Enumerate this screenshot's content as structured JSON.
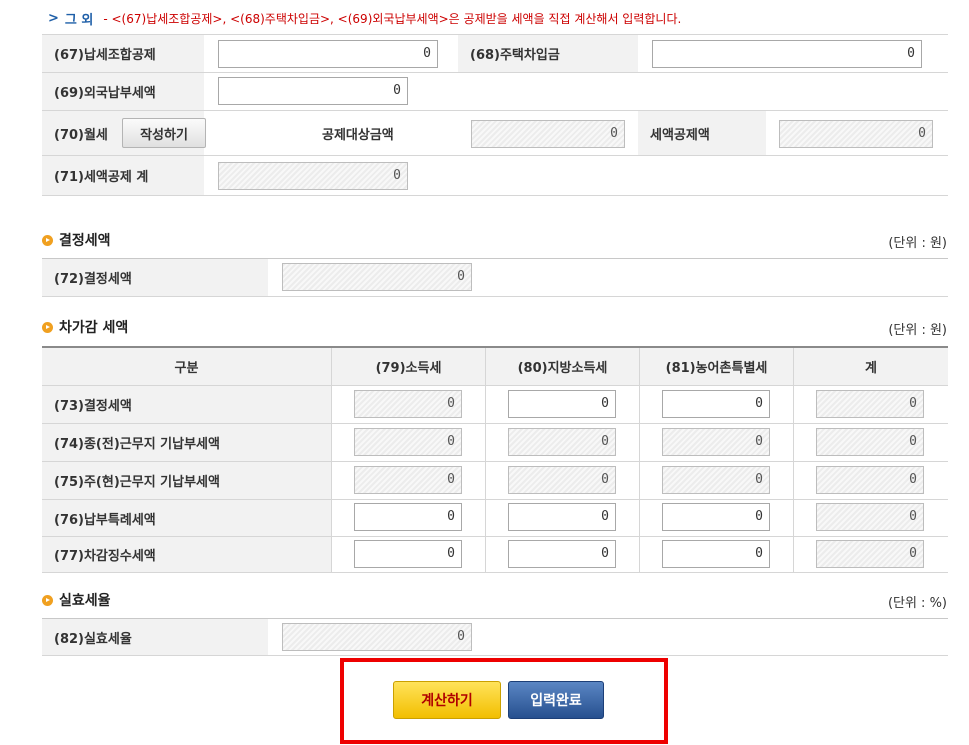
{
  "notice": {
    "bullet": ">",
    "title": "그 외",
    "text": "- <(67)납세조합공제>, <(68)주택차입금>, <(69)외국납부세액>은 공제받을 세액을 직접 계산해서 입력합니다."
  },
  "other": {
    "f67_label": "(67)납세조합공제",
    "f67_value": "0",
    "f68_label": "(68)주택차입금",
    "f68_value": "0",
    "f69_label": "(69)외국납부세액",
    "f69_value": "0",
    "f70_label": "(70)월세",
    "f70_button": "작성하기",
    "base_label": "공제대상금액",
    "base_value": "0",
    "credit_label": "세액공제액",
    "credit_value": "0",
    "f71_label": "(71)세액공제 계",
    "f71_value": "0"
  },
  "determined": {
    "title": "결정세액",
    "unit": "(단위 : 원)",
    "f72_label": "(72)결정세액",
    "f72_value": "0"
  },
  "deduction": {
    "title": "차가감 세액",
    "unit": "(단위 : 원)",
    "headers": [
      "구분",
      "(79)소득세",
      "(80)지방소득세",
      "(81)농어촌특별세",
      "계"
    ],
    "rows": [
      {
        "label": "(73)결정세액",
        "values": [
          "0",
          "0",
          "0",
          "0"
        ]
      },
      {
        "label": "(74)종(전)근무지 기납부세액",
        "values": [
          "0",
          "0",
          "0",
          "0"
        ]
      },
      {
        "label": "(75)주(현)근무지 기납부세액",
        "values": [
          "0",
          "0",
          "0",
          "0"
        ]
      },
      {
        "label": "(76)납부특례세액",
        "values": [
          "0",
          "0",
          "0",
          "0"
        ]
      },
      {
        "label": "(77)차감징수세액",
        "values": [
          "0",
          "0",
          "0",
          "0"
        ]
      }
    ]
  },
  "effective": {
    "title": "실효세율",
    "unit": "(단위 : %)",
    "f82_label": "(82)실효세율",
    "f82_value": "0"
  },
  "buttons": {
    "calculate": "계산하기",
    "complete": "입력완료"
  },
  "colors": {
    "notice_red": "#cc0000",
    "accent_blue": "#1e5fa8",
    "bullet_orange": "#f0a020",
    "highlight_red": "#ee0000",
    "calc_yellow": "#f5c400"
  }
}
